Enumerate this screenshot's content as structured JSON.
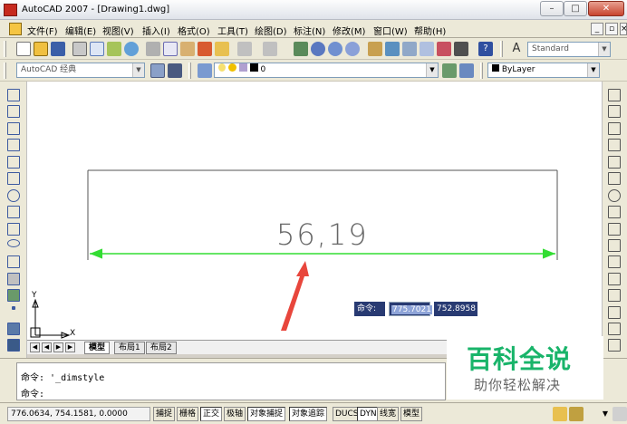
{
  "window": {
    "title": "AutoCAD 2007 - [Drawing1.dwg]"
  },
  "menu": {
    "items": [
      "文件(F)",
      "编辑(E)",
      "视图(V)",
      "插入(I)",
      "格式(O)",
      "工具(T)",
      "绘图(D)",
      "标注(N)",
      "修改(M)",
      "窗口(W)",
      "帮助(H)"
    ]
  },
  "toolbar": {
    "text_style": "Standard",
    "workspace": "AutoCAD 经典",
    "layer": "0",
    "linetype": "ByLayer"
  },
  "drawing": {
    "dimension_text": "56,19",
    "ucs_x_label": "X",
    "ucs_y_label": "Y"
  },
  "dynamic_input": {
    "label": "命令:",
    "x_value": "775.7021",
    "y_value": "752.8958"
  },
  "tabs": [
    "模型",
    "布局1",
    "布局2"
  ],
  "command": {
    "history": "命令: '_dimstyle",
    "prompt": "命令:"
  },
  "status": {
    "coordinates": "776.0634, 754.1581, 0.0000",
    "toggles": [
      "捕捉",
      "栅格",
      "正交",
      "极轴",
      "对象捕捉",
      "对象追踪",
      "DUCS",
      "DYN",
      "线宽",
      "模型"
    ]
  },
  "watermark": {
    "title": "百科全说",
    "subtitle": "助你轻松解决"
  },
  "colors": {
    "dimension_line": "#33dd33",
    "annotation_arrow": "#e8463c",
    "watermark_green": "#19b46a"
  }
}
